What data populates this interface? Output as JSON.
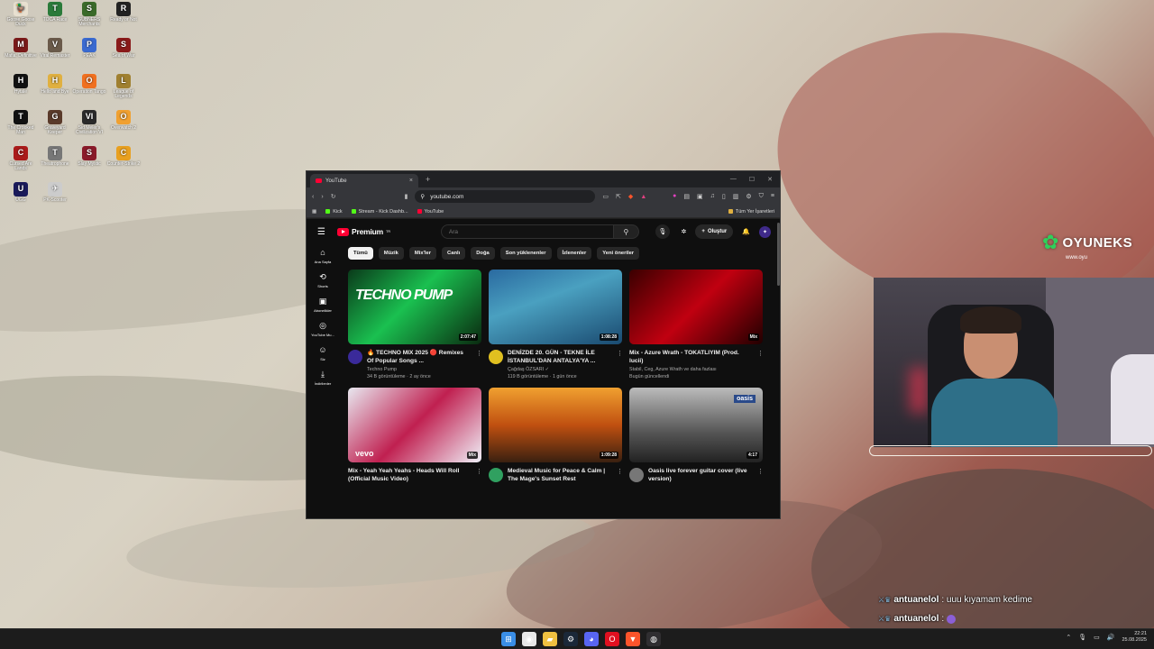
{
  "desktop": {
    "icons": [
      {
        "label": "Goose Goose Duck",
        "color": "#e8e0d0",
        "glyph": "🦆"
      },
      {
        "label": "TOCA Race",
        "color": "#2a7a3a",
        "glyph": "T"
      },
      {
        "label": "SUBNERS Merchants",
        "color": "#3a6a2a",
        "glyph": "S"
      },
      {
        "label": "Ready or Not",
        "color": "#222222",
        "glyph": "R"
      },
      {
        "label": "Mafia: Definitive",
        "color": "#7a1a1a",
        "glyph": "M"
      },
      {
        "label": "Viral Remaster",
        "color": "#6a5a4a",
        "glyph": "V"
      },
      {
        "label": "PEAK",
        "color": "#3a6ad0",
        "glyph": "P"
      },
      {
        "label": "Sea of War",
        "color": "#8a1a1a",
        "glyph": "S"
      },
      {
        "label": "Hytale",
        "color": "#111111",
        "glyph": "H"
      },
      {
        "label": "Hello and Bye",
        "color": "#e0b040",
        "glyph": "H"
      },
      {
        "label": "Operation Tango",
        "color": "#f07020",
        "glyph": "O"
      },
      {
        "label": "League of Legends",
        "color": "#a08030",
        "glyph": "L"
      },
      {
        "label": "The Crooked Man",
        "color": "#111111",
        "glyph": "T"
      },
      {
        "label": "Graveyard Keeper",
        "color": "#5a3a2a",
        "glyph": "G"
      },
      {
        "label": "Sid Meier's Civilization VI",
        "color": "#2a2a2a",
        "glyph": "VI"
      },
      {
        "label": "Overwatch 2",
        "color": "#f0a030",
        "glyph": "O"
      },
      {
        "label": "Cursed Are Lands",
        "color": "#aa1a1a",
        "glyph": "C"
      },
      {
        "label": "Theatrophone",
        "color": "#777777",
        "glyph": "T"
      },
      {
        "label": "Slay Mystic",
        "color": "#8a1a2a",
        "glyph": "S"
      },
      {
        "label": "Counter-Strike 2",
        "color": "#e8a020",
        "glyph": "C"
      },
      {
        "label": "UGG",
        "color": "#1a1a5a",
        "glyph": "U"
      },
      {
        "label": "PK-Scooter",
        "color": "#cccccc",
        "glyph": "✈"
      }
    ]
  },
  "browser": {
    "tab_title": "YouTube",
    "tab_close": "×",
    "new_tab": "+",
    "window_controls": [
      "—",
      "☐",
      "✕"
    ],
    "url": "youtube.com",
    "bookmarks": [
      {
        "label": "Kick",
        "color": "#53fc18"
      },
      {
        "label": "Stream - Kick Dashb...",
        "color": "#53fc18"
      },
      {
        "label": "YouTube",
        "color": "#ff0033"
      }
    ],
    "bookmarks_right": "Tüm Yer İşaretleri"
  },
  "youtube": {
    "logo_text": "Premium",
    "logo_region": "TR",
    "search_placeholder": "Ara",
    "create_label": "Oluştur",
    "avatar_glyph": "✦",
    "guide": [
      {
        "label": "Ana Sayfa",
        "icon": "home-icon",
        "glyph": "⌂"
      },
      {
        "label": "Shorts",
        "icon": "shorts-icon",
        "glyph": "⟲"
      },
      {
        "label": "Abonelikler",
        "icon": "subscriptions-icon",
        "glyph": "▣"
      },
      {
        "label": "YouTube Mu...",
        "icon": "music-icon",
        "glyph": "◎"
      },
      {
        "label": "Siz",
        "icon": "you-icon",
        "glyph": "☺"
      },
      {
        "label": "İndirilenler",
        "icon": "download-icon",
        "glyph": "⤓"
      }
    ],
    "chips": [
      "Tümü",
      "Müzik",
      "Mix'ler",
      "Canlı",
      "Doğa",
      "Son yüklenenler",
      "İzlenenler",
      "Yeni öneriler"
    ],
    "videos": [
      {
        "title": "🔥 TECHNO MIX 2025 🔴 Remixes Of Popular Songs ...",
        "channel": "Techno Pump",
        "stats": "34 B görüntüleme · 2 ay önce",
        "duration": "2:07:47",
        "thumb_bg": "linear-gradient(135deg,#0a3a1a,#1ac050 45%,#0a2a10)",
        "thumb_text": "TECHNO PUMP",
        "avatar_color": "#3a2a9a"
      },
      {
        "title": "DENİZDE 20. GÜN - TEKNE İLE İSTANBUL'DAN ANTALYA'YA ...",
        "channel": "Çağdaş ÖZSARI ✓",
        "stats": "119 B görüntüleme · 1 gün önce",
        "duration": "1:08:28",
        "thumb_bg": "linear-gradient(160deg,#2a6aa0,#4aa0c0 40%,#1a4a70)",
        "thumb_text": "",
        "avatar_color": "#e0c020"
      },
      {
        "title": "Mix - Azure Wrath - TOKATLIYIM (Prod. lucii)",
        "channel": "Stabil, Ceg, Azure Wrath ve daha fazlası",
        "stats": "Bugün güncellendi",
        "duration": "Mix",
        "thumb_bg": "linear-gradient(135deg,#3a0000,#c00010 50%,#200000)",
        "thumb_text": "",
        "avatar_color": ""
      },
      {
        "title": "Mix - Yeah Yeah Yeahs - Heads Will Roll (Official Music Video)",
        "channel": "",
        "stats": "",
        "duration": "Mix",
        "thumb_bg": "linear-gradient(135deg,#e8e8f0,#c02050 50%,#f0f0f8)",
        "thumb_text": "vevo",
        "avatar_color": ""
      },
      {
        "title": "Medieval Music for Peace & Calm | The Mage's Sunset Rest",
        "channel": "",
        "stats": "",
        "duration": "1:09:28",
        "thumb_bg": "linear-gradient(180deg,#f0a030,#c05010 50%,#3a2010)",
        "thumb_text": "",
        "avatar_color": "#30a060"
      },
      {
        "title": "Oasis live forever guitar cover (live version)",
        "channel": "",
        "stats": "",
        "duration": "4:17",
        "thumb_bg": "linear-gradient(180deg,#bbbbbb,#555555 60%,#222222)",
        "thumb_text": "oasis",
        "avatar_color": "#777777"
      }
    ]
  },
  "overlay": {
    "brand_name": "OYUNEKS",
    "brand_url": "www.oyu"
  },
  "chat": [
    {
      "user": "antuanelol",
      "message": ": uuu kıyamam kedime"
    },
    {
      "user": "antuanelol",
      "message": ":"
    }
  ],
  "taskbar": {
    "apps": [
      {
        "name": "windows-start-icon",
        "color": "#3a8ee6",
        "glyph": "⊞"
      },
      {
        "name": "chrome-icon",
        "color": "#e8e8e8",
        "glyph": "◉"
      },
      {
        "name": "file-explorer-icon",
        "color": "#f0c040",
        "glyph": "▰"
      },
      {
        "name": "steam-icon",
        "color": "#1b2838",
        "glyph": "⚙"
      },
      {
        "name": "discord-icon",
        "color": "#5865f2",
        "glyph": "◕"
      },
      {
        "name": "opera-icon",
        "color": "#e01020",
        "glyph": "O"
      },
      {
        "name": "brave-icon",
        "color": "#fb542b",
        "glyph": "▼"
      },
      {
        "name": "obs-icon",
        "color": "#302e31",
        "glyph": "◍"
      }
    ],
    "time": "22:21",
    "date": "25.08.2025"
  }
}
